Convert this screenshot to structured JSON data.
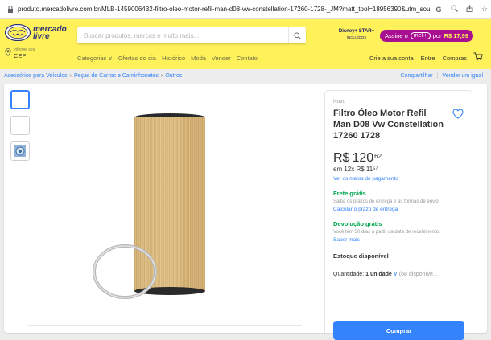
{
  "browser": {
    "url": "produto.mercadolivre.com.br/MLB-1459006432-filtro-oleo-motor-refil-man-d08-vw-constellation-17260-1728-_JM?matt_tool=18956390&utm_source=..."
  },
  "header": {
    "logo_line1": "mercado",
    "logo_line2": "livre",
    "search_placeholder": "Buscar produtos, marcas e muito mais...",
    "promo": {
      "disney_line1": "Disney+ STAR+",
      "disney_line2": "INCLUÍDOS",
      "assine": "Assine o",
      "meli": "meli+",
      "por": "por",
      "price": "R$ 17,99"
    },
    "cep_line1": "Informe seu",
    "cep_line2": "CEP",
    "nav": [
      "Categorias",
      "Ofertas do dia",
      "Histórico",
      "Moda",
      "Vender",
      "Contato"
    ],
    "right_nav": [
      "Crie a sua conta",
      "Entre",
      "Compras"
    ]
  },
  "breadcrumb": {
    "items": [
      "Acessórios para Veículos",
      "Peças de Carros e Caminhonetes",
      "Outros"
    ],
    "share": "Compartilhar",
    "sell": "Vender um igual"
  },
  "product": {
    "condition": "Novo",
    "title": "Filtro Óleo Motor Refil Man D08 Vw Constellation 17260 1728",
    "price_currency": "R$",
    "price_int": "120",
    "price_cents": "62",
    "installments": "em 12x R$ 11⁵⁷",
    "payment_link": "Ver os meios de pagamento",
    "shipping_title": "Frete grátis",
    "shipping_desc": "Saiba os prazos de entrega e as formas de envio.",
    "shipping_link": "Calcular o prazo de entrega",
    "return_title": "Devolução grátis",
    "return_desc": "Você tem 30 dias a partir da data de recebimento.",
    "return_link": "Saber mais",
    "stock": "Estoque disponível",
    "qty_label": "Quantidade:",
    "qty_value": "1 unidade",
    "qty_available": "(68 disponíve...",
    "buy_label": "Comprar"
  }
}
